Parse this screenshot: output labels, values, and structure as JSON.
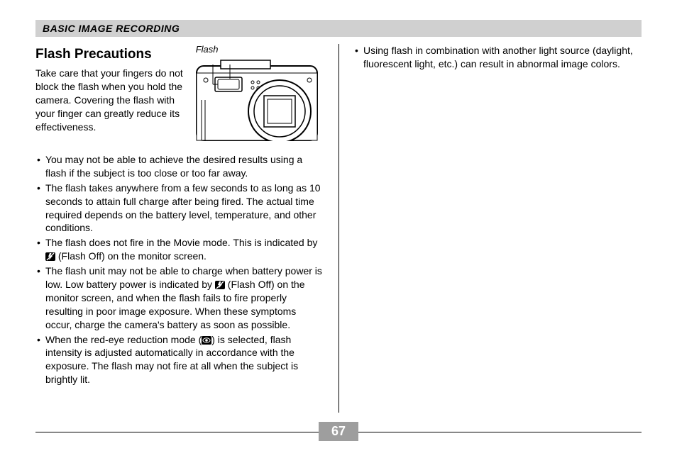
{
  "header": "BASIC IMAGE RECORDING",
  "section_title": "Flash Precautions",
  "figure_label": "Flash",
  "intro": "Take care that your fingers do not block the flash when you hold the camera. Covering the flash with your finger can greatly reduce its effectiveness.",
  "left_bullets": [
    "You may not be able to achieve the desired results using a flash if the subject is too close or too far away.",
    "The flash takes anywhere from a few seconds to as long as 10 seconds to attain full charge after being fired. The actual time required depends on the battery level, temperature, and other conditions.",
    "The flash does not fire in the Movie mode. This is indicated by __FLASHOFF__ (Flash Off) on the monitor screen.",
    "The flash unit may not be able to charge when battery power is low. Low battery power is indicated by __FLASHOFF__ (Flash Off) on the monitor screen, and when the flash fails to fire properly resulting in poor image exposure. When these symptoms occur, charge the camera's battery as soon as possible.",
    "When the red-eye reduction mode (__REDEYE__) is selected, flash intensity is adjusted automatically in accordance with the exposure. The flash may not fire at all when the subject is brightly lit."
  ],
  "right_bullets": [
    "Using flash in combination with another light source (daylight, fluorescent light, etc.) can result in abnormal image colors."
  ],
  "page_number": "67"
}
